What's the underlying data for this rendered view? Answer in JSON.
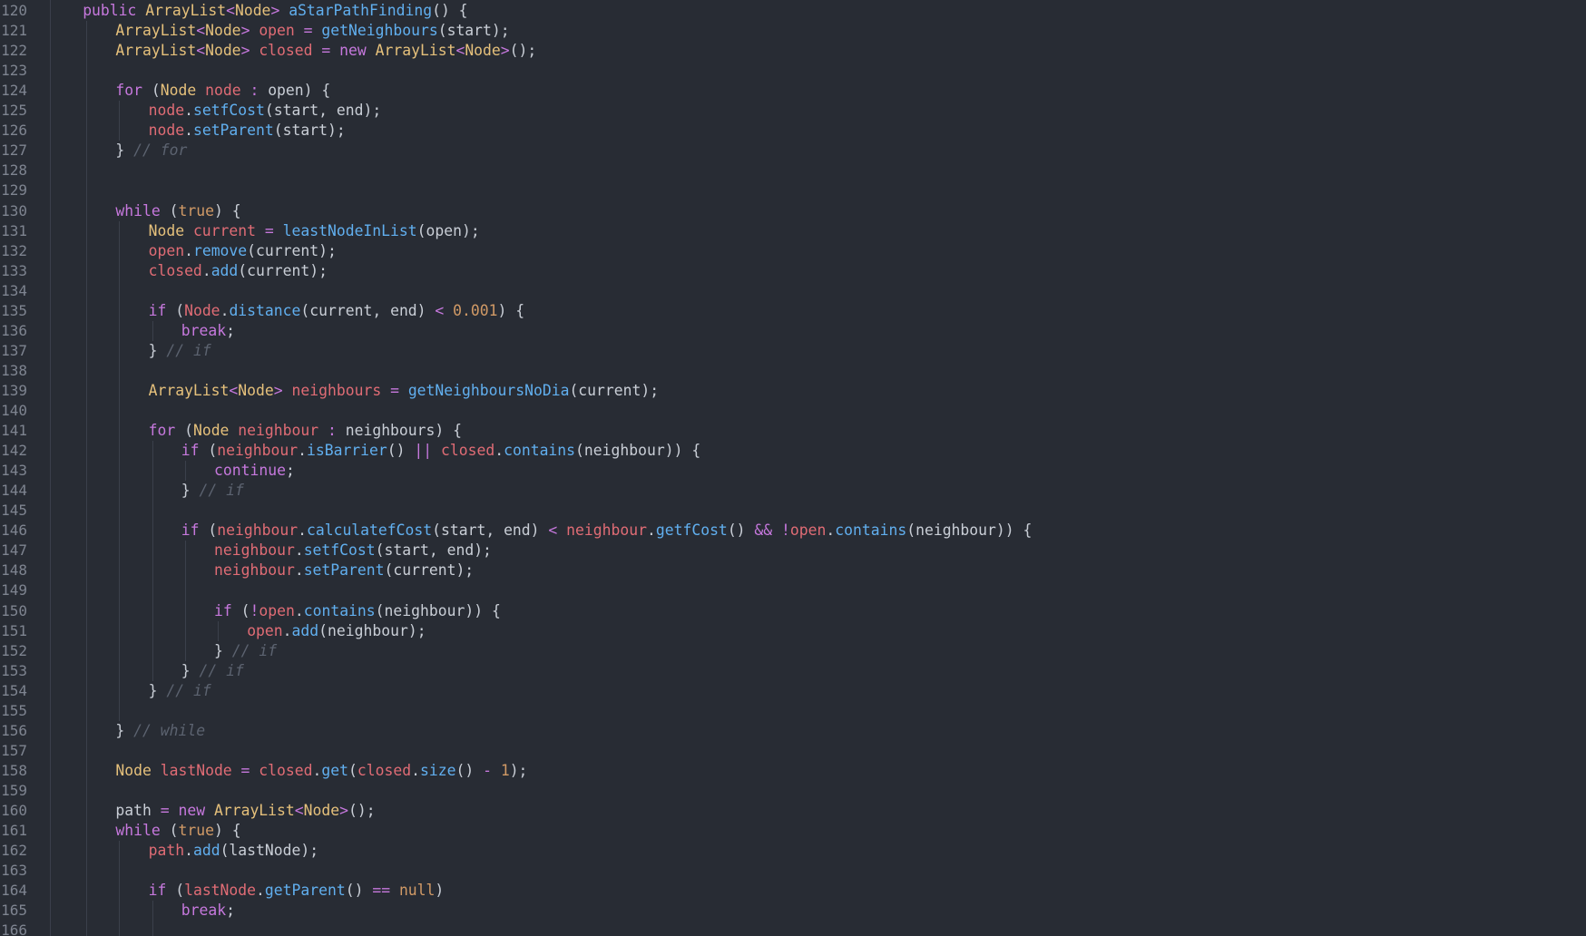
{
  "theme": {
    "background": "#282c34",
    "gutter_text": "#7e8490",
    "plain": "#c9ced6",
    "keyword": "#c678dd",
    "type": "#e5c07b",
    "function": "#61afef",
    "variable": "#e06c75",
    "number": "#d19a66",
    "comment": "#5c6370"
  },
  "lines": [
    {
      "num": "120",
      "indent": 1,
      "tokens": [
        [
          "kw",
          "public "
        ],
        [
          "ty",
          "ArrayList"
        ],
        [
          "op",
          "<"
        ],
        [
          "ty",
          "Node"
        ],
        [
          "op",
          "> "
        ],
        [
          "fn",
          "aStarPathFinding"
        ],
        [
          "pl",
          "() {"
        ]
      ]
    },
    {
      "num": "121",
      "indent": 2,
      "tokens": [
        [
          "ty",
          "ArrayList"
        ],
        [
          "op",
          "<"
        ],
        [
          "ty",
          "Node"
        ],
        [
          "op",
          "> "
        ],
        [
          "var",
          "open"
        ],
        [
          "op",
          " = "
        ],
        [
          "fn",
          "getNeighbours"
        ],
        [
          "pl",
          "(start);"
        ]
      ]
    },
    {
      "num": "122",
      "indent": 2,
      "tokens": [
        [
          "ty",
          "ArrayList"
        ],
        [
          "op",
          "<"
        ],
        [
          "ty",
          "Node"
        ],
        [
          "op",
          "> "
        ],
        [
          "var",
          "closed"
        ],
        [
          "op",
          " = "
        ],
        [
          "kw",
          "new "
        ],
        [
          "ty",
          "ArrayList"
        ],
        [
          "op",
          "<"
        ],
        [
          "ty",
          "Node"
        ],
        [
          "op",
          ">"
        ],
        [
          "pl",
          "();"
        ]
      ]
    },
    {
      "num": "123",
      "indent": 0,
      "tokens": []
    },
    {
      "num": "124",
      "indent": 2,
      "tokens": [
        [
          "kw",
          "for "
        ],
        [
          "pl",
          "("
        ],
        [
          "ty",
          "Node "
        ],
        [
          "var",
          "node"
        ],
        [
          "op",
          " : "
        ],
        [
          "pl",
          "open) {"
        ]
      ]
    },
    {
      "num": "125",
      "indent": 3,
      "tokens": [
        [
          "var",
          "node"
        ],
        [
          "pl",
          "."
        ],
        [
          "fn",
          "setfCost"
        ],
        [
          "pl",
          "(start, end);"
        ]
      ]
    },
    {
      "num": "126",
      "indent": 3,
      "tokens": [
        [
          "var",
          "node"
        ],
        [
          "pl",
          "."
        ],
        [
          "fn",
          "setParent"
        ],
        [
          "pl",
          "(start);"
        ]
      ]
    },
    {
      "num": "127",
      "indent": 2,
      "tokens": [
        [
          "pl",
          "} "
        ],
        [
          "cm",
          "// for"
        ]
      ]
    },
    {
      "num": "128",
      "indent": 0,
      "tokens": []
    },
    {
      "num": "129",
      "indent": 0,
      "tokens": []
    },
    {
      "num": "130",
      "indent": 2,
      "tokens": [
        [
          "kw",
          "while "
        ],
        [
          "pl",
          "("
        ],
        [
          "num",
          "true"
        ],
        [
          "pl",
          ") {"
        ]
      ]
    },
    {
      "num": "131",
      "indent": 3,
      "tokens": [
        [
          "ty",
          "Node "
        ],
        [
          "var",
          "current"
        ],
        [
          "op",
          " = "
        ],
        [
          "fn",
          "leastNodeInList"
        ],
        [
          "pl",
          "(open);"
        ]
      ]
    },
    {
      "num": "132",
      "indent": 3,
      "tokens": [
        [
          "var",
          "open"
        ],
        [
          "pl",
          "."
        ],
        [
          "fn",
          "remove"
        ],
        [
          "pl",
          "(current);"
        ]
      ]
    },
    {
      "num": "133",
      "indent": 3,
      "tokens": [
        [
          "var",
          "closed"
        ],
        [
          "pl",
          "."
        ],
        [
          "fn",
          "add"
        ],
        [
          "pl",
          "(current);"
        ]
      ]
    },
    {
      "num": "134",
      "indent": 0,
      "tokens": []
    },
    {
      "num": "135",
      "indent": 3,
      "tokens": [
        [
          "kw",
          "if "
        ],
        [
          "pl",
          "("
        ],
        [
          "var",
          "Node"
        ],
        [
          "pl",
          "."
        ],
        [
          "fn",
          "distance"
        ],
        [
          "pl",
          "(current, end) "
        ],
        [
          "op",
          "< "
        ],
        [
          "num",
          "0.001"
        ],
        [
          "pl",
          ") {"
        ]
      ]
    },
    {
      "num": "136",
      "indent": 4,
      "tokens": [
        [
          "kw",
          "break"
        ],
        [
          "pl",
          ";"
        ]
      ]
    },
    {
      "num": "137",
      "indent": 3,
      "tokens": [
        [
          "pl",
          "} "
        ],
        [
          "cm",
          "// if"
        ]
      ]
    },
    {
      "num": "138",
      "indent": 0,
      "tokens": []
    },
    {
      "num": "139",
      "indent": 3,
      "tokens": [
        [
          "ty",
          "ArrayList"
        ],
        [
          "op",
          "<"
        ],
        [
          "ty",
          "Node"
        ],
        [
          "op",
          "> "
        ],
        [
          "var",
          "neighbours"
        ],
        [
          "op",
          " = "
        ],
        [
          "fn",
          "getNeighboursNoDia"
        ],
        [
          "pl",
          "(current);"
        ]
      ]
    },
    {
      "num": "140",
      "indent": 0,
      "tokens": []
    },
    {
      "num": "141",
      "indent": 3,
      "tokens": [
        [
          "kw",
          "for "
        ],
        [
          "pl",
          "("
        ],
        [
          "ty",
          "Node "
        ],
        [
          "var",
          "neighbour"
        ],
        [
          "op",
          " : "
        ],
        [
          "pl",
          "neighbours) {"
        ]
      ]
    },
    {
      "num": "142",
      "indent": 4,
      "tokens": [
        [
          "kw",
          "if "
        ],
        [
          "pl",
          "("
        ],
        [
          "var",
          "neighbour"
        ],
        [
          "pl",
          "."
        ],
        [
          "fn",
          "isBarrier"
        ],
        [
          "pl",
          "() "
        ],
        [
          "op",
          "|| "
        ],
        [
          "var",
          "closed"
        ],
        [
          "pl",
          "."
        ],
        [
          "fn",
          "contains"
        ],
        [
          "pl",
          "(neighbour)) {"
        ]
      ]
    },
    {
      "num": "143",
      "indent": 5,
      "tokens": [
        [
          "kw",
          "continue"
        ],
        [
          "pl",
          ";"
        ]
      ]
    },
    {
      "num": "144",
      "indent": 4,
      "tokens": [
        [
          "pl",
          "} "
        ],
        [
          "cm",
          "// if"
        ]
      ]
    },
    {
      "num": "145",
      "indent": 0,
      "tokens": []
    },
    {
      "num": "146",
      "indent": 4,
      "tokens": [
        [
          "kw",
          "if "
        ],
        [
          "pl",
          "("
        ],
        [
          "var",
          "neighbour"
        ],
        [
          "pl",
          "."
        ],
        [
          "fn",
          "calculatefCost"
        ],
        [
          "pl",
          "(start, end) "
        ],
        [
          "op",
          "< "
        ],
        [
          "var",
          "neighbour"
        ],
        [
          "pl",
          "."
        ],
        [
          "fn",
          "getfCost"
        ],
        [
          "pl",
          "() "
        ],
        [
          "op",
          "&& !"
        ],
        [
          "var",
          "open"
        ],
        [
          "pl",
          "."
        ],
        [
          "fn",
          "contains"
        ],
        [
          "pl",
          "(neighbour)) {"
        ]
      ]
    },
    {
      "num": "147",
      "indent": 5,
      "tokens": [
        [
          "var",
          "neighbour"
        ],
        [
          "pl",
          "."
        ],
        [
          "fn",
          "setfCost"
        ],
        [
          "pl",
          "(start, end);"
        ]
      ]
    },
    {
      "num": "148",
      "indent": 5,
      "tokens": [
        [
          "var",
          "neighbour"
        ],
        [
          "pl",
          "."
        ],
        [
          "fn",
          "setParent"
        ],
        [
          "pl",
          "(current);"
        ]
      ]
    },
    {
      "num": "149",
      "indent": 0,
      "tokens": []
    },
    {
      "num": "150",
      "indent": 5,
      "tokens": [
        [
          "kw",
          "if "
        ],
        [
          "pl",
          "("
        ],
        [
          "op",
          "!"
        ],
        [
          "var",
          "open"
        ],
        [
          "pl",
          "."
        ],
        [
          "fn",
          "contains"
        ],
        [
          "pl",
          "(neighbour)) {"
        ]
      ]
    },
    {
      "num": "151",
      "indent": 6,
      "tokens": [
        [
          "var",
          "open"
        ],
        [
          "pl",
          "."
        ],
        [
          "fn",
          "add"
        ],
        [
          "pl",
          "(neighbour);"
        ]
      ]
    },
    {
      "num": "152",
      "indent": 5,
      "tokens": [
        [
          "pl",
          "} "
        ],
        [
          "cm",
          "// if"
        ]
      ]
    },
    {
      "num": "153",
      "indent": 4,
      "tokens": [
        [
          "pl",
          "} "
        ],
        [
          "cm",
          "// if"
        ]
      ]
    },
    {
      "num": "154",
      "indent": 3,
      "tokens": [
        [
          "pl",
          "} "
        ],
        [
          "cm",
          "// if"
        ]
      ]
    },
    {
      "num": "155",
      "indent": 0,
      "tokens": []
    },
    {
      "num": "156",
      "indent": 2,
      "tokens": [
        [
          "pl",
          "} "
        ],
        [
          "cm",
          "// while"
        ]
      ]
    },
    {
      "num": "157",
      "indent": 0,
      "tokens": []
    },
    {
      "num": "158",
      "indent": 2,
      "tokens": [
        [
          "ty",
          "Node "
        ],
        [
          "var",
          "lastNode"
        ],
        [
          "op",
          " = "
        ],
        [
          "var",
          "closed"
        ],
        [
          "pl",
          "."
        ],
        [
          "fn",
          "get"
        ],
        [
          "pl",
          "("
        ],
        [
          "var",
          "closed"
        ],
        [
          "pl",
          "."
        ],
        [
          "fn",
          "size"
        ],
        [
          "pl",
          "() "
        ],
        [
          "op",
          "- "
        ],
        [
          "num",
          "1"
        ],
        [
          "pl",
          ");"
        ]
      ]
    },
    {
      "num": "159",
      "indent": 0,
      "tokens": []
    },
    {
      "num": "160",
      "indent": 2,
      "tokens": [
        [
          "pl",
          "path "
        ],
        [
          "op",
          "= "
        ],
        [
          "kw",
          "new "
        ],
        [
          "ty",
          "ArrayList"
        ],
        [
          "op",
          "<"
        ],
        [
          "ty",
          "Node"
        ],
        [
          "op",
          ">"
        ],
        [
          "pl",
          "();"
        ]
      ]
    },
    {
      "num": "161",
      "indent": 2,
      "tokens": [
        [
          "kw",
          "while "
        ],
        [
          "pl",
          "("
        ],
        [
          "num",
          "true"
        ],
        [
          "pl",
          ") {"
        ]
      ]
    },
    {
      "num": "162",
      "indent": 3,
      "tokens": [
        [
          "var",
          "path"
        ],
        [
          "pl",
          "."
        ],
        [
          "fn",
          "add"
        ],
        [
          "pl",
          "(lastNode);"
        ]
      ]
    },
    {
      "num": "163",
      "indent": 0,
      "tokens": []
    },
    {
      "num": "164",
      "indent": 3,
      "tokens": [
        [
          "kw",
          "if "
        ],
        [
          "pl",
          "("
        ],
        [
          "var",
          "lastNode"
        ],
        [
          "pl",
          "."
        ],
        [
          "fn",
          "getParent"
        ],
        [
          "pl",
          "() "
        ],
        [
          "op",
          "== "
        ],
        [
          "num",
          "null"
        ],
        [
          "pl",
          ")"
        ]
      ]
    },
    {
      "num": "165",
      "indent": 4,
      "tokens": [
        [
          "kw",
          "break"
        ],
        [
          "pl",
          ";"
        ]
      ]
    },
    {
      "num": "166",
      "indent": 0,
      "tokens": []
    }
  ]
}
